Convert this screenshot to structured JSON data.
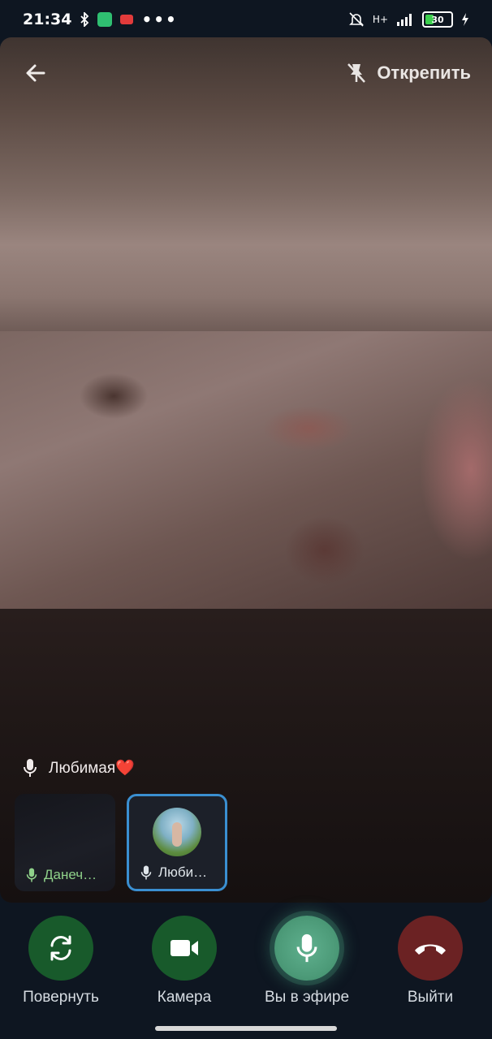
{
  "status_bar": {
    "time": "21:34",
    "battery": "30",
    "network": "H+"
  },
  "top_bar": {
    "unpin_label": "Открепить"
  },
  "speaker": {
    "name": "Любимая❤️"
  },
  "thumbnails": [
    {
      "label": "Данеч…",
      "mic": "green"
    },
    {
      "label": "Люби…",
      "mic": "white",
      "active": true
    }
  ],
  "controls": {
    "rotate": "Повернуть",
    "camera": "Камера",
    "on_air": "Вы в эфире",
    "leave": "Выйти"
  },
  "colors": {
    "background": "#0e1621",
    "control_green": "#185a2b",
    "air_green": "#4d9b79",
    "leave_red": "#6b2223",
    "active_thumb_border": "#3a8fd1"
  }
}
